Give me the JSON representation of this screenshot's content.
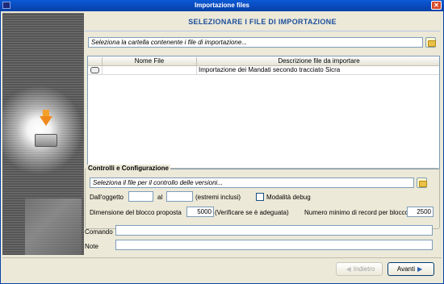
{
  "window": {
    "title": "Importazione files"
  },
  "header": {
    "heading": "SELEZIONARE I FILE DI IMPORTAZIONE"
  },
  "folder": {
    "placeholder": "Seleziona la cartella contenente i file di importazione...",
    "browse_icon": "folder-icon"
  },
  "table": {
    "columns": [
      "",
      "Nome File",
      "Descrizione file da importare"
    ],
    "rows": [
      {
        "name": "",
        "description": "Importazione dei Mandati secondo tracciato Sicra",
        "icon": "file-type-icon"
      }
    ]
  },
  "controls": {
    "group_title": "Controlli e Configurazione",
    "version_placeholder": "Seleziona il file per il controllo delle versioni...",
    "from_label": "Dall'oggetto",
    "from_value": "",
    "to_label": "al",
    "to_value": "",
    "inclusive_note": "(estremi inclusi)",
    "debug_label": "Modalità debug",
    "debug_checked": false,
    "block_label": "Dimensione del blocco proposta",
    "block_value": "5000",
    "block_hint": "(Verificare se è adeguata)",
    "min_records_label": "Numero minimo di record per blocco",
    "min_records_value": "2500"
  },
  "command": {
    "label": "Comando",
    "value": ""
  },
  "notes": {
    "label": "Note",
    "value": ""
  },
  "footer": {
    "back_label": "Indietro",
    "back_enabled": false,
    "next_label": "Avanti",
    "next_enabled": true
  },
  "colors": {
    "titlebar": "#0a4bc0",
    "heading": "#1e4e9a",
    "window_bg": "#ece9d8"
  }
}
